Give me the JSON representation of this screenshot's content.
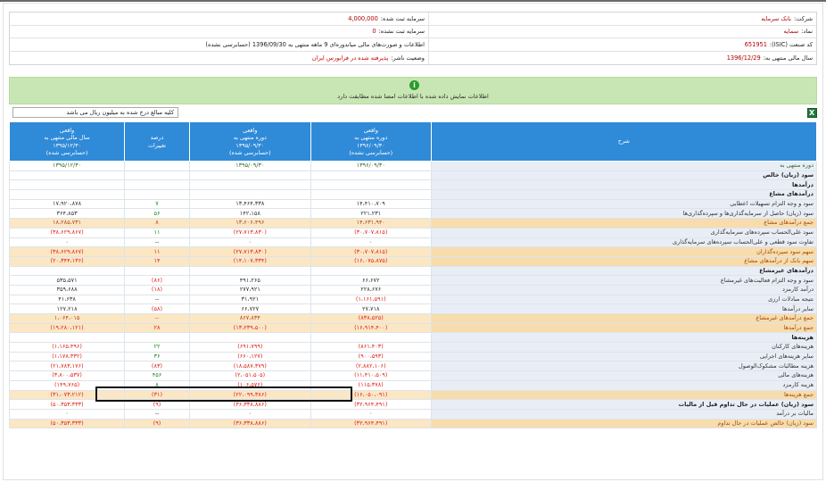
{
  "info": {
    "company_label": "شرکت:",
    "company_value": "بانک سرمایه",
    "symbol_label": "نماد:",
    "symbol_value": "سمایه",
    "isic_label": "کد صنعت (ISIC):",
    "isic_value": "651951",
    "fiscal_label": "سال مالی منتهی به:",
    "fiscal_value": "1396/12/29",
    "registered_capital_label": "سرمایه ثبت شده:",
    "registered_capital_value": "4,000,000",
    "unregistered_capital_label": "سرمایه ثبت نشده:",
    "unregistered_capital_value": "0",
    "statement_text": "اطلاعات و صورت‌های مالی میاندوره‌ای 9 ماهه منتهی به 1396/09/30 (حسابرسی نشده)",
    "status_label": "وضعیت ناشر:",
    "status_value": "پذیرفته شده در فرابورس ایران"
  },
  "notice": {
    "icon": "info-icon",
    "text": "اطلاعات نمایش داده شده با اطلاعات امضا شده مطابقت دارد"
  },
  "unit_note": "کلیه مبالغ درج شده به میلیون ریال می باشد",
  "excel_icon": "excel-icon",
  "table": {
    "headers": {
      "desc": "شرح",
      "col1": [
        "واقعی",
        "دوره منتهی به",
        "۱۳۹۶/۰۹/۳۰",
        "(حسابرسی نشده)"
      ],
      "col2": [
        "واقعی",
        "دوره منتهی به",
        "۱۳۹۵/۰۹/۳۰",
        "(حسابرسی شده)"
      ],
      "col3": [
        "درصد",
        "تغییرات"
      ],
      "col4": [
        "واقعی",
        "سال مالی منتهی به",
        "۱۳۹۵/۱۲/۳۰",
        "(حسابرسی شده)"
      ]
    },
    "rows": [
      {
        "desc": "دوره منتهی به",
        "c1": "۱۳۹۶/۰۹/۳۰",
        "c2": "۱۳۹۵/۰۹/۳۰",
        "c3": "",
        "c4": "۱۳۹۵/۱۲/۳۰",
        "kind": "period"
      },
      {
        "desc": "سود (زیان) خالص",
        "c1": "",
        "c2": "",
        "c3": "",
        "c4": "",
        "kind": "bold"
      },
      {
        "desc": "درآمدها",
        "c1": "",
        "c2": "",
        "c3": "",
        "c4": "",
        "kind": "bold"
      },
      {
        "desc": "درآمدهای مشاع",
        "c1": "",
        "c2": "",
        "c3": "",
        "c4": "",
        "kind": "bold"
      },
      {
        "desc": "سود و وجه التزام تسهیلات اعطایی",
        "c1": "۱۴،۴۱۰،۷۰۹",
        "c2": "۱۳،۴۶۴،۳۳۸",
        "c3": "۷",
        "c4": "۱۷،۹۲۰،۸۷۸",
        "kind": "",
        "c3color": "green"
      },
      {
        "desc": "سود (زیان) حاصل از سرمایه‌گذاری‌ها و سپرده‌گذاری‌ها",
        "c1": "۲۲۱،۲۳۱",
        "c2": "۱۴۲،۱۵۸",
        "c3": "۵۶",
        "c4": "۳۶۴،۸۵۳",
        "kind": "",
        "c3color": "green"
      },
      {
        "desc": "جمع درآمدهای مشاع",
        "c1": "۱۴،۶۳۱،۹۴۰",
        "c2": "۱۳،۶۰۶،۴۹۶",
        "c3": "۸",
        "c4": "۱۸،۲۸۵،۷۳۱",
        "kind": "total"
      },
      {
        "desc": "سود علی‌الحساب سپرده‌های سرمایه‌گذاری",
        "c1": "(۳۰،۷۰۷،۸۱۵)",
        "c2": "(۲۷،۷۱۳،۸۳۰)",
        "c3": "۱۱",
        "c4": "(۳۸،۶۲۹،۸۶۷)",
        "kind": "",
        "neg": true,
        "c3color": "green"
      },
      {
        "desc": "تفاوت سود قطعی و علی‌الحساب سپرده‌های سرمایه‌گذاری",
        "c1": "۰",
        "c2": "۰",
        "c3": "--",
        "c4": "۰",
        "kind": ""
      },
      {
        "desc": "سهم سود سپرده‌گذاران",
        "c1": "(۳۰،۷۰۷،۸۱۵)",
        "c2": "(۲۷،۷۱۳،۸۳۰)",
        "c3": "۱۱",
        "c4": "(۳۸،۶۲۹،۸۶۷)",
        "kind": "total",
        "neg": true
      },
      {
        "desc": "سهم بانک از درآمدهای مشاع",
        "c1": "(۱۶،۰۷۵،۸۷۵)",
        "c2": "(۱۴،۱۰۷،۳۳۴)",
        "c3": "۱۴",
        "c4": "(۲۰،۳۴۴،۱۳۶)",
        "kind": "total",
        "neg": true
      },
      {
        "desc": "درآمدهای غیرمشاع",
        "c1": "",
        "c2": "",
        "c3": "",
        "c4": "",
        "kind": "bold"
      },
      {
        "desc": "سود و وجه التزام فعالیت‌های غیرمشاع",
        "c1": "۶۶،۶۷۲",
        "c2": "۴۹۱،۲۶۵",
        "c3": "(۸۶)",
        "c4": "۵۳۵،۵۷۱",
        "kind": "",
        "c3color": "red"
      },
      {
        "desc": "درآمد کارمزد",
        "c1": "۲۲۸،۶۷۶",
        "c2": "۲۷۷،۹۲۱",
        "c3": "(۱۸)",
        "c4": "۳۵۹،۶۸۸",
        "kind": "",
        "c3color": "red"
      },
      {
        "desc": "نتیجه مبادلات ارزی",
        "c1": "(۱،۱۶۱،۵۹۱)",
        "c2": "۳۱،۹۲۱",
        "c3": "--",
        "c4": "۴۱،۶۳۸",
        "kind": "",
        "c1neg": true
      },
      {
        "desc": "سایر درآمدها",
        "c1": "۲۷،۷۱۸",
        "c2": "۶۶،۷۲۷",
        "c3": "(۵۸)",
        "c4": "۱۲۷،۲۱۸",
        "kind": "",
        "c3color": "red"
      },
      {
        "desc": "جمع درآمدهای غیرمشاع",
        "c1": "(۸۳۸،۵۲۵)",
        "c2": "۸۶۷،۸۳۴",
        "c3": "--",
        "c4": "۱،۰۶۴،۰۱۵",
        "kind": "total",
        "c1neg": true
      },
      {
        "desc": "جمع درآمدها",
        "c1": "(۱۶،۹۱۴،۴۰۰)",
        "c2": "(۱۳،۲۳۹،۵۰۰)",
        "c3": "۲۸",
        "c4": "(۱۹،۲۸۰،۱۲۱)",
        "kind": "total",
        "neg": true
      },
      {
        "desc": "هزینه‌ها",
        "c1": "",
        "c2": "",
        "c3": "",
        "c4": "",
        "kind": "bold"
      },
      {
        "desc": "هزینه‌های کارکنان",
        "c1": "(۸۶۱،۴۰۳)",
        "c2": "(۶۹۱،۷۹۹)",
        "c3": "۲۲",
        "c4": "(۱،۱۶۵،۴۹۶)",
        "kind": "",
        "neg": true,
        "c3color": "green"
      },
      {
        "desc": "سایر هزینه‌های اجرایی",
        "c1": "(۹۰۰،۵۹۳)",
        "c2": "(۶۶۰،۱۲۷)",
        "c3": "۳۶",
        "c4": "(۱،۱۷۸،۳۳۲)",
        "kind": "",
        "neg": true,
        "c3color": "green"
      },
      {
        "desc": "هزینه مطالبات مشکوک‌الوصول",
        "c1": "(۲،۸۸۲،۱۰۶)",
        "c2": "(۱۸،۵۸۷،۳۷۹)",
        "c3": "(۸۳)",
        "c4": "(۲۱،۷۸۳،۱۷۶)",
        "kind": "",
        "neg": true
      },
      {
        "desc": "هزینه‌های مالی",
        "c1": "(۱۱،۴۱۰،۵۰۹)",
        "c2": "(۲،۰۵۱،۵۰۵)",
        "c3": "۴۵۶",
        "c4": "(۳،۸۰۰،۵۳۷)",
        "kind": "",
        "neg": true,
        "c3color": "green"
      },
      {
        "desc": "هزینه کارمزد",
        "c1": "(۱۱۵،۳۷۸)",
        "c2": "(۱۰۶،۵۷۶)",
        "c3": "۸",
        "c4": "(۱۴۹،۷۶۵)",
        "kind": "",
        "neg": true,
        "c3color": "green"
      },
      {
        "desc": "جمع هزینه‌ها",
        "c1": "(۱۶،۰۵۰،۰۹۱)",
        "c2": "(۲۲،۰۹۹،۳۸۶)",
        "c3": "(۳۱)",
        "c4": "(۳۱،۰۷۳،۲۱۲)",
        "kind": "total",
        "neg": true
      },
      {
        "desc": "سود (زیان) عملیات در حال تداوم قبل از مالیات",
        "c1": "(۳۲،۹۶۴،۴۹۱)",
        "c2": "(۳۶،۳۳۸،۸۸۶)",
        "c3": "(۹)",
        "c4": "(۵۰،۳۵۳،۳۳۳)",
        "kind": "bold",
        "neg": true
      },
      {
        "desc": "مالیات بر درآمد",
        "c1": "۰",
        "c2": "۰",
        "c3": "--",
        "c4": "۰",
        "kind": ""
      },
      {
        "desc": "سود (زیان) خالص عملیات در حال تداوم",
        "c1": "(۳۲،۹۶۴،۴۹۱)",
        "c2": "(۳۶،۳۳۸،۸۸۶)",
        "c3": "(۹)",
        "c4": "(۵۰،۳۵۳،۳۳۳)",
        "kind": "total",
        "neg": true
      }
    ]
  }
}
